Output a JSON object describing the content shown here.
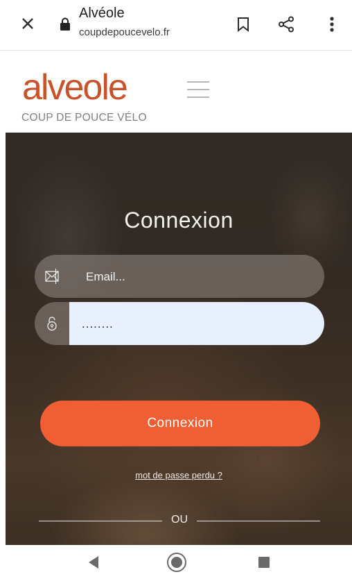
{
  "browser": {
    "page_title": "Alvéole",
    "host": "coupdepoucevelo.fr"
  },
  "site": {
    "logo_text": "alveole",
    "tagline": "COUP DE POUCE VÉLO",
    "brand_color": "#c8532a"
  },
  "login": {
    "title": "Connexion",
    "email_placeholder": "Email...",
    "password_value": "........",
    "submit_label": "Connexion",
    "lost_password_link": "mot de passe perdu ?",
    "divider_text": "OU",
    "button_color": "#f05f33"
  }
}
